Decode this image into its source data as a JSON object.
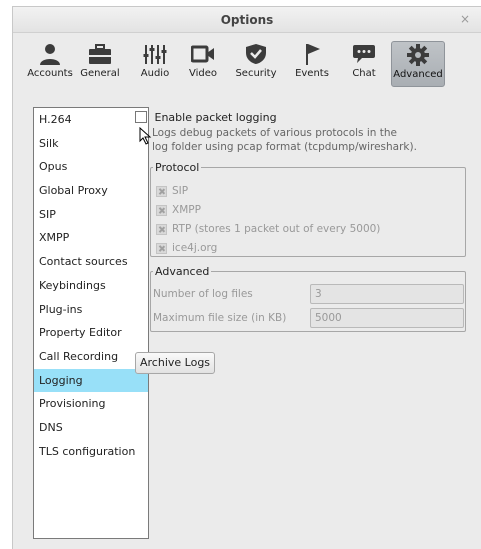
{
  "window": {
    "title": "Options",
    "close_icon": "×"
  },
  "toolbar": {
    "items": [
      {
        "label": "Accounts",
        "icon": "person-icon"
      },
      {
        "label": "General",
        "icon": "briefcase-icon"
      },
      {
        "label": "Audio",
        "icon": "equalizer-icon"
      },
      {
        "label": "Video",
        "icon": "video-camera-icon"
      },
      {
        "label": "Security",
        "icon": "shield-icon"
      },
      {
        "label": "Events",
        "icon": "flag-icon"
      },
      {
        "label": "Chat",
        "icon": "chat-bubble-icon"
      },
      {
        "label": "Advanced",
        "icon": "gear-icon",
        "selected": true
      }
    ]
  },
  "sidebar": {
    "items": [
      {
        "label": "H.264"
      },
      {
        "label": "Silk"
      },
      {
        "label": "Opus"
      },
      {
        "label": "Global Proxy"
      },
      {
        "label": "SIP"
      },
      {
        "label": "XMPP"
      },
      {
        "label": "Contact sources"
      },
      {
        "label": "Keybindings"
      },
      {
        "label": "Plug-ins"
      },
      {
        "label": "Property Editor"
      },
      {
        "label": "Call Recording"
      },
      {
        "label": "Logging",
        "selected": true
      },
      {
        "label": "Provisioning"
      },
      {
        "label": "DNS"
      },
      {
        "label": "TLS configuration"
      }
    ]
  },
  "logging": {
    "enable_label": "Enable packet logging",
    "enable_checked": false,
    "description_line1": "Logs debug packets of various protocols in the",
    "description_line2": "log folder using pcap format (tcpdump/wireshark).",
    "protocol": {
      "legend": "Protocol",
      "items": [
        {
          "label": "SIP",
          "checked": true,
          "enabled": false
        },
        {
          "label": "XMPP",
          "checked": true,
          "enabled": false
        },
        {
          "label": "RTP (stores 1 packet out of every 5000)",
          "checked": true,
          "enabled": false
        },
        {
          "label": "ice4j.org",
          "checked": true,
          "enabled": false
        }
      ]
    },
    "advanced": {
      "legend": "Advanced",
      "log_files_label": "Number of log files",
      "log_files_value": "3",
      "max_size_label": "Maximum file size (in KB)",
      "max_size_value": "5000"
    },
    "archive_button": "Archive Logs"
  },
  "colors": {
    "window_bg": "#ebebeb",
    "selection": "#98e0f8",
    "toolbar_selected": "#b5b9bd"
  }
}
